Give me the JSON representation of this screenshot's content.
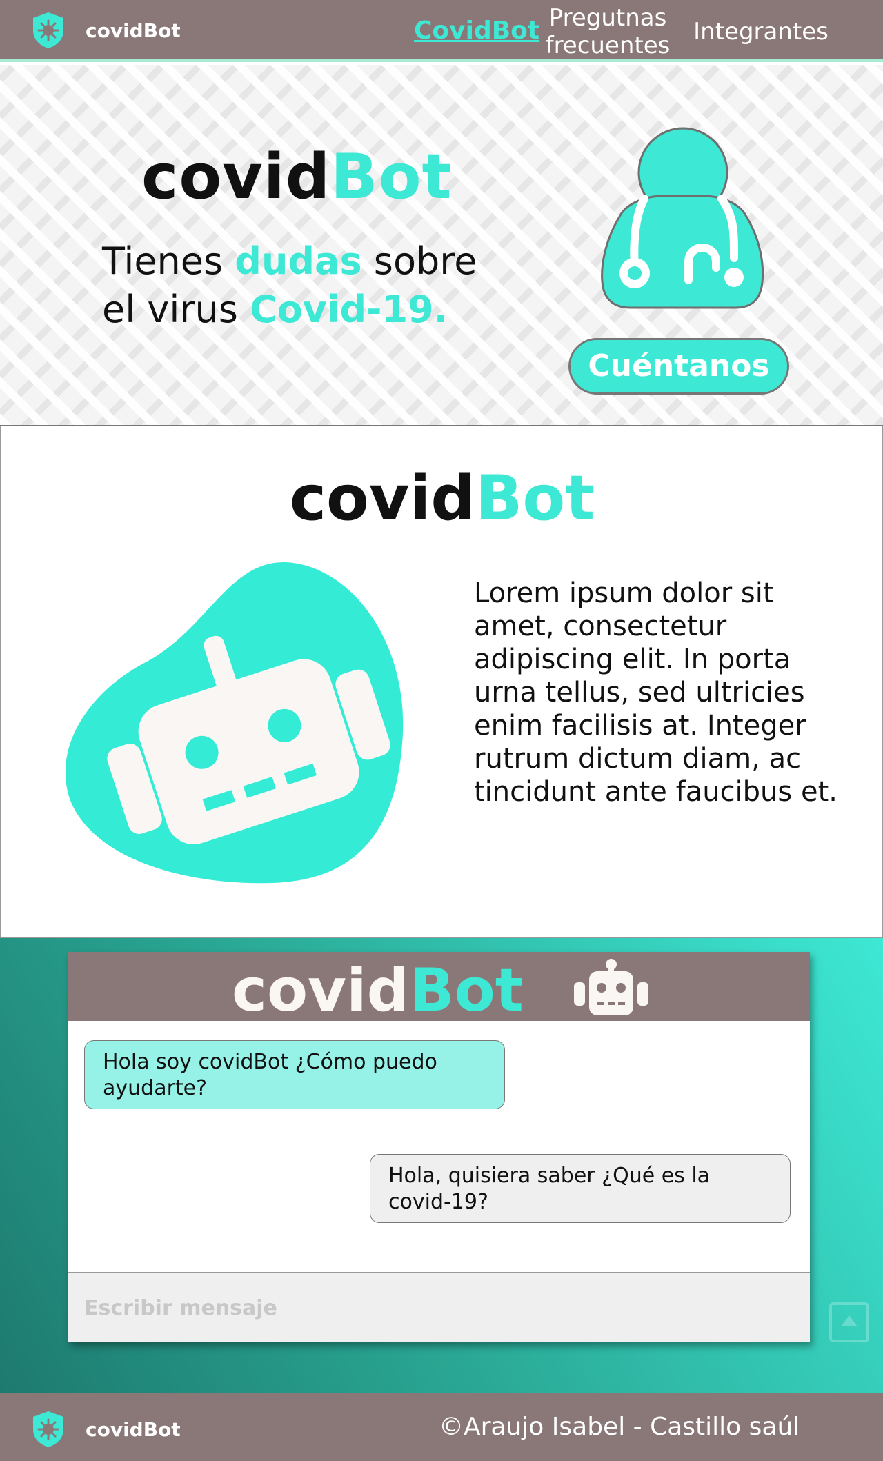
{
  "header": {
    "brand": "covidBot",
    "nav": [
      {
        "label": "CovidBot",
        "active": true
      },
      {
        "label_line1": "Pregutnas",
        "label_line2": "frecuentes"
      },
      {
        "label": "Integrantes"
      }
    ]
  },
  "hero": {
    "title_part1": "covid",
    "title_part2": "Bot",
    "line1_a": "Tienes ",
    "line1_b": "dudas",
    "line1_c": " sobre",
    "line2_a": "el virus ",
    "line2_b": "Covid-19.",
    "cta_label": "Cuéntanos"
  },
  "about": {
    "title_part1": "covid",
    "title_part2": "Bot",
    "text": "Lorem ipsum dolor sit amet, consectetur adipiscing elit. In porta urna tellus, sed ultricies enim facilisis at. Integer rutrum dictum diam, ac tincidunt ante faucibus et."
  },
  "chat": {
    "title_part1": "covid",
    "title_part2": "Bot",
    "messages": [
      {
        "from": "bot",
        "text": "Hola soy covidBot ¿Cómo puedo ayudarte?"
      },
      {
        "from": "user",
        "text": "Hola, quisiera saber ¿Qué es la covid-19?"
      }
    ],
    "input_placeholder": "Escribir mensaje"
  },
  "footer": {
    "brand": "covidBot",
    "copyright": "©Araujo Isabel - Castillo saúl"
  },
  "colors": {
    "accent": "#3de8d4",
    "bar": "#8a7878",
    "bot_bubble": "#96f2e6",
    "user_bubble": "#efefef"
  },
  "icons": [
    "shield-virus-icon",
    "doctor-icon",
    "robot-icon",
    "scroll-top-icon"
  ]
}
